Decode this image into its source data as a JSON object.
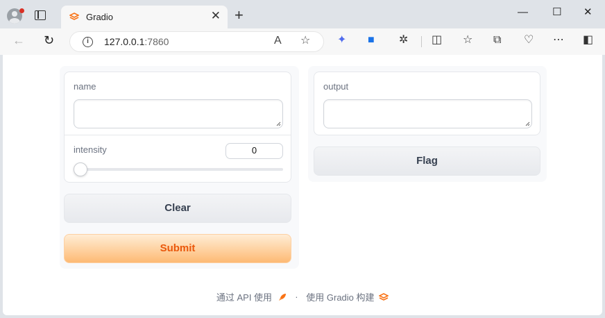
{
  "browser": {
    "tab_title": "Gradio",
    "tab_close": "✕",
    "new_tab": "+",
    "url_host": "127.0.0.1",
    "url_port": ":7860",
    "window": {
      "minimize": "—",
      "maximize": "☐",
      "close": "✕"
    }
  },
  "form": {
    "name_label": "name",
    "name_value": "",
    "intensity_label": "intensity",
    "intensity_value": "0",
    "slider": {
      "min": 0,
      "value": 0
    },
    "clear_label": "Clear",
    "submit_label": "Submit"
  },
  "output_panel": {
    "output_label": "output",
    "output_value": "",
    "flag_label": "Flag"
  },
  "footer": {
    "api_text": "通过 API 使用",
    "separator": "·",
    "built_text": "使用 Gradio 构建"
  },
  "colors": {
    "accent": "#ea580c",
    "primary_gradient_start": "#ffedd5",
    "primary_gradient_end": "#fdba74"
  }
}
